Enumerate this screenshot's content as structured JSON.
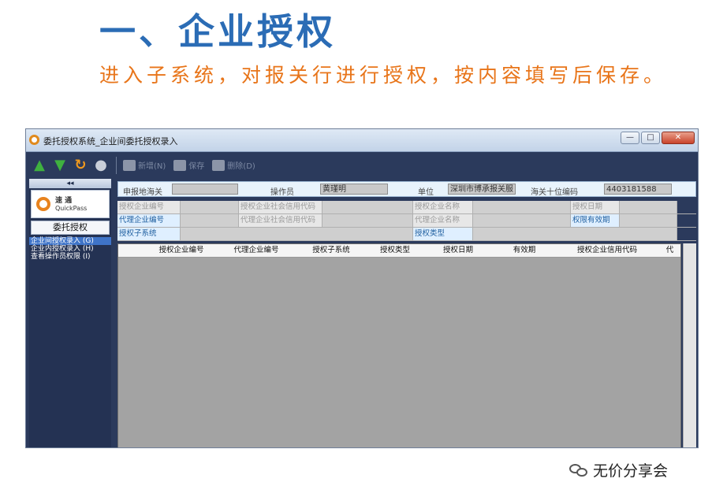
{
  "heading": "一、企业授权",
  "subheading": "进入子系统，对报关行进行授权，按内容填写后保存。",
  "window": {
    "title": "委托授权系统_企业间委托授权录入",
    "controls": {
      "minimize": "—",
      "maximize": "□",
      "close": "✕"
    }
  },
  "toolbar": {
    "icons": [
      "arrow-up-icon",
      "arrow-down-icon",
      "refresh-icon",
      "globe-icon"
    ],
    "new_label": "新增(N)",
    "save_label": "保存",
    "delete_label": "删除(D)"
  },
  "sidebar": {
    "collapse": "◂◂",
    "logo_cn": "速 通",
    "logo_en": "QuickPass",
    "title": "委托授权",
    "items": [
      {
        "label": "企业间授权录入 (G)",
        "active": true
      },
      {
        "label": "企业内授权录入 (H)",
        "active": false
      },
      {
        "label": "查看操作员权限 (I)",
        "active": false
      }
    ]
  },
  "form": {
    "customs_label": "申报地海关",
    "customs_value": "",
    "operator_label": "操作员",
    "operator_value": "黄瑾明",
    "unit_label": "单位",
    "unit_value": "深圳市博承报关服",
    "code_label": "海关十位编码",
    "code_value": "4403181588",
    "grantor_no_label": "授权企业编号",
    "grantor_credit_label": "授权企业社会信用代码",
    "grantor_name_label": "授权企业名称",
    "grant_date_label": "授权日期",
    "agent_no_label": "代理企业编号",
    "agent_credit_label": "代理企业社会信用代码",
    "agent_name_label": "代理企业名称",
    "validity_label": "权限有效期",
    "subsystem_label": "授权子系统",
    "grant_type_label": "授权类型"
  },
  "table": {
    "columns": [
      "授权企业编号",
      "代理企业编号",
      "授权子系统",
      "授权类型",
      "授权日期",
      "有效期",
      "授权企业信用代码",
      "代"
    ]
  },
  "watermark": "无价分享会"
}
